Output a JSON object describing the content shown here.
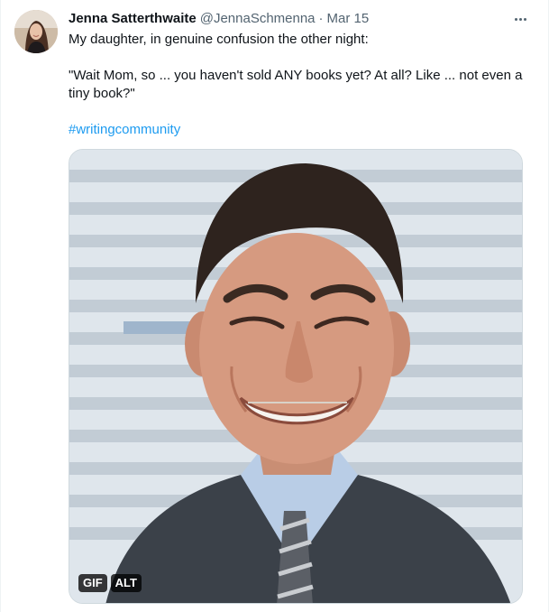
{
  "tweet": {
    "display_name": "Jenna Satterthwaite",
    "handle": "@JennaSchmenna",
    "separator": "·",
    "date": "Mar 15",
    "text_line1": "My daughter, in genuine confusion the other night:",
    "text_quote": "\"Wait Mom, so ... you haven't sold ANY books yet? At all? Like ... not even a tiny book?\"",
    "hashtag": "#writingcommunity"
  },
  "media": {
    "type": "gif",
    "gif_badge": "GIF",
    "alt_badge": "ALT"
  },
  "icons": {
    "more": "more-horizontal-icon"
  },
  "colors": {
    "link": "#1d9bf0",
    "secondary_text": "#536471",
    "primary_text": "#0f1419",
    "border": "#cfd9de"
  }
}
